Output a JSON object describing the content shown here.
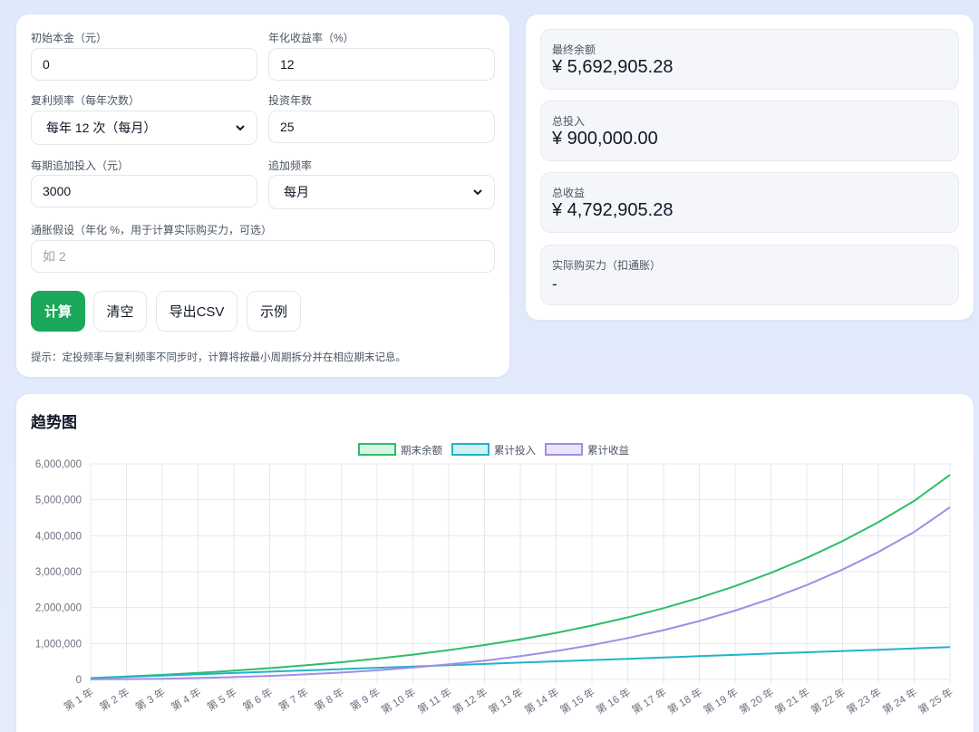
{
  "form": {
    "principal": {
      "label": "初始本金（元）",
      "value": "0"
    },
    "rate": {
      "label": "年化收益率（%）",
      "value": "12"
    },
    "compound": {
      "label": "复利频率（每年次数）",
      "selected": "每年 12 次（每月）"
    },
    "years": {
      "label": "投资年数",
      "value": "25"
    },
    "contribution": {
      "label": "每期追加投入（元）",
      "value": "3000"
    },
    "contribution_freq": {
      "label": "追加频率",
      "selected": "每月"
    },
    "inflation": {
      "label": "通胀假设（年化 %，用于计算实际购买力，可选）",
      "placeholder": "如 2"
    },
    "buttons": {
      "calculate": "计算",
      "clear": "清空",
      "export": "导出CSV",
      "example": "示例"
    },
    "hint": "提示：定投频率与复利频率不同步时，计算将按最小周期拆分并在相应期末记息。"
  },
  "summary": {
    "final_balance": {
      "label": "最终余额",
      "value": "¥ 5,692,905.28"
    },
    "total_invested": {
      "label": "总投入",
      "value": "¥ 900,000.00"
    },
    "total_return": {
      "label": "总收益",
      "value": "¥ 4,792,905.28"
    },
    "real_value": {
      "label": "实际购买力（扣通胀）",
      "value": "-"
    }
  },
  "chart": {
    "title": "趋势图"
  },
  "chart_data": {
    "type": "line",
    "categories": [
      "第 1 年",
      "第 2 年",
      "第 3 年",
      "第 4 年",
      "第 5 年",
      "第 6 年",
      "第 7 年",
      "第 8 年",
      "第 9 年",
      "第 10 年",
      "第 11 年",
      "第 12 年",
      "第 13 年",
      "第 14 年",
      "第 15 年",
      "第 16 年",
      "第 17 年",
      "第 18 年",
      "第 19 年",
      "第 20 年",
      "第 21 年",
      "第 22 年",
      "第 23 年",
      "第 24 年",
      "第 25 年"
    ],
    "series": [
      {
        "name": "期末余额",
        "color": "#2ebd68",
        "fill": "#d7f5e2",
        "values": [
          38048,
          80924,
          129239,
          183682,
          245029,
          314158,
          392053,
          479828,
          578736,
          690190,
          815779,
          957295,
          1116761,
          1296453,
          1498935,
          1727101,
          1984209,
          2273931,
          2600402,
          2968277,
          3382813,
          3849935,
          4376313,
          4969456,
          5692905
        ]
      },
      {
        "name": "累计投入",
        "color": "#1fb5c7",
        "fill": "#d2f1f5",
        "values": [
          36000,
          72000,
          108000,
          144000,
          180000,
          216000,
          252000,
          288000,
          324000,
          360000,
          396000,
          432000,
          468000,
          504000,
          540000,
          576000,
          612000,
          648000,
          684000,
          720000,
          756000,
          792000,
          828000,
          864000,
          900000
        ]
      },
      {
        "name": "累计收益",
        "color": "#a48be6",
        "fill": "#ebe5fb",
        "values": [
          2048,
          8924,
          21239,
          39682,
          65029,
          98158,
          140053,
          191828,
          254736,
          330190,
          419779,
          525295,
          648761,
          792453,
          958935,
          1151101,
          1372209,
          1625931,
          1916402,
          2248277,
          2626813,
          3057935,
          3548313,
          4105456,
          4792905
        ]
      }
    ],
    "ylim": [
      0,
      6000000
    ],
    "yticks": [
      "6,000,000",
      "5,000,000",
      "4,000,000",
      "3,000,000",
      "2,000,000",
      "1,000,000",
      "0"
    ],
    "legend": "top-center",
    "grid": true
  }
}
